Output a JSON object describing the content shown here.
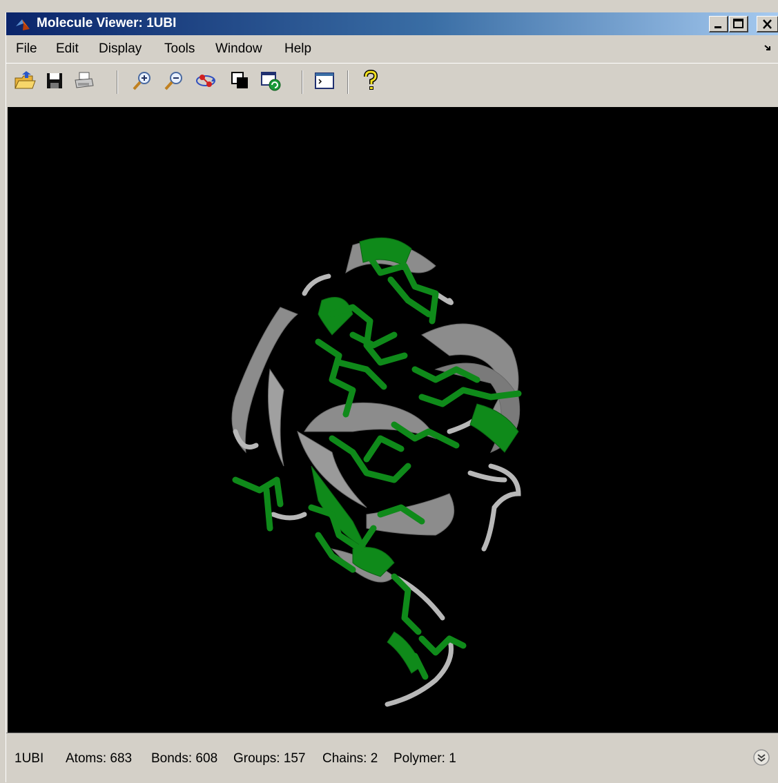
{
  "window": {
    "title": "Molecule Viewer: 1UBI",
    "app_icon": "matlab-logo-icon",
    "controls": [
      "minimize-icon",
      "maximize-icon",
      "close-icon"
    ]
  },
  "menu": {
    "items": [
      "File",
      "Edit",
      "Display",
      "Tools",
      "Window",
      "Help"
    ],
    "dock_icon": "dock-arrow-icon"
  },
  "toolbar": {
    "buttons": [
      {
        "name": "open-file",
        "icon": "open-folder-icon"
      },
      {
        "name": "save",
        "icon": "floppy-disk-icon"
      },
      {
        "name": "print",
        "icon": "printer-icon"
      },
      {
        "name": "zoom-in",
        "icon": "zoom-in-icon"
      },
      {
        "name": "zoom-out",
        "icon": "zoom-out-icon"
      },
      {
        "name": "rotate",
        "icon": "molecule-rotate-icon"
      },
      {
        "name": "copy-figure",
        "icon": "copy-windows-icon"
      },
      {
        "name": "refresh-view",
        "icon": "refresh-window-icon"
      },
      {
        "name": "command-window",
        "icon": "command-window-icon"
      },
      {
        "name": "help",
        "icon": "question-mark-icon"
      }
    ]
  },
  "viewer": {
    "background": "#000000",
    "ribbon_color": "#8c8c8c",
    "highlight_color": "#0f8a1a"
  },
  "status": {
    "pdb_id": "1UBI",
    "atoms": "Atoms: 683",
    "bonds": "Bonds: 608",
    "groups": "Groups: 157",
    "chains": "Chains: 2",
    "polymer": "Polymer: 1",
    "expand_icon": "double-chevron-down-icon"
  }
}
